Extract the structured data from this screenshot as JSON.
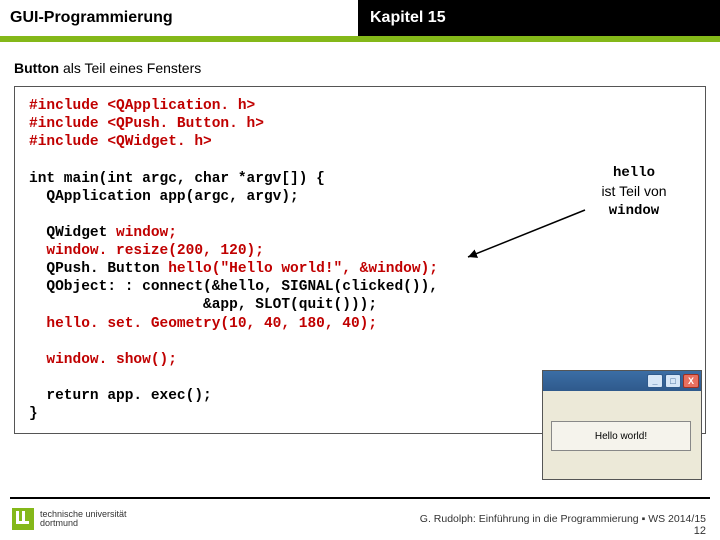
{
  "header": {
    "left": "GUI-Programmierung",
    "right": "Kapitel 15"
  },
  "subtitle": {
    "bold": "Button",
    "rest": " als Teil eines Fensters"
  },
  "code": {
    "inc1": "#include <QApplication. h>",
    "inc2": "#include <QPush. Button. h>",
    "inc3": "#include <QWidget. h>",
    "l1": "int main(int argc, char *argv[]) {",
    "l2": "  QApplication app(argc, argv);",
    "l3a": "  QWidget ",
    "l3b": "window;",
    "l4a": "  ",
    "l4b": "window. resize(200, 120);",
    "l5a": "  QPush. Button ",
    "l5b": "hello(\"Hello world!\", &window);",
    "l6": "  QObject: : connect(&hello, SIGNAL(clicked()),",
    "l7": "                    &app, SLOT(quit()));",
    "l8a": "  ",
    "l8b": "hello. set. Geometry(10, 40, 180, 40);",
    "l9a": "  ",
    "l9b": "window. show();",
    "l10": "  return app. exec();",
    "l11": "}"
  },
  "annotation": {
    "hello": "hello",
    "line2": "ist Teil von",
    "window": "window"
  },
  "mockwin": {
    "min": "_",
    "max": "□",
    "close": "X",
    "button_label": "Hello world!"
  },
  "logo": {
    "line1": "technische universität",
    "line2": "dortmund"
  },
  "credit": "G. Rudolph: Einführung in die Programmierung ▪ WS 2014/15",
  "pagenum": "12"
}
